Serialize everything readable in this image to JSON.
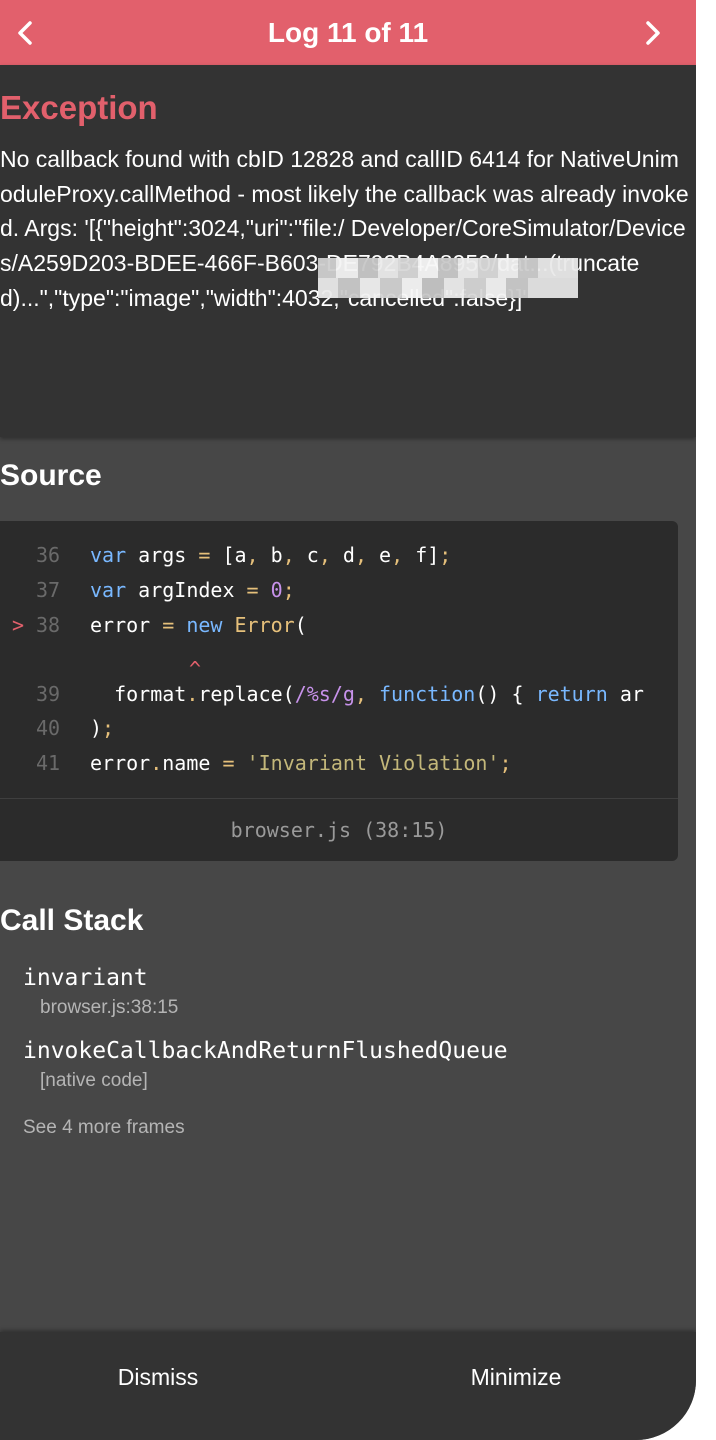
{
  "header": {
    "title": "Log 11 of 11",
    "background_color": "#e2606c",
    "prev_icon": "chevron-left-icon",
    "next_icon": "chevron-right-icon"
  },
  "exception": {
    "heading": "Exception",
    "message": "No callback found with cbID 12828 and callID 6414 for NativeUnimoduleProxy.callMethod - most likely the callback was already invoked. Args: '[{\"height\":3024,\"uri\":\"file:/                            Developer/CoreSimulator/Devices/A259D203-BDEE-466F-B603-DE792B4A8950/dat...(truncated)...\",\"type\":\"image\",\"width\":4032,\"cancelled\":false}]'"
  },
  "source": {
    "title": "Source",
    "lines": [
      {
        "marker": "",
        "number": "36",
        "code": "var args = [a, b, c, d, e, f];"
      },
      {
        "marker": "",
        "number": "37",
        "code": "var argIndex = 0;"
      },
      {
        "marker": ">",
        "number": "38",
        "code": "error = new Error("
      },
      {
        "marker": "",
        "number": "",
        "code": "^"
      },
      {
        "marker": "",
        "number": "39",
        "code": "  format.replace(/%s/g, function() { return ar"
      },
      {
        "marker": "",
        "number": "40",
        "code": ");"
      },
      {
        "marker": "",
        "number": "41",
        "code": "error.name = 'Invariant Violation';"
      }
    ],
    "file_location": "browser.js (38:15)"
  },
  "call_stack": {
    "title": "Call Stack",
    "frames": [
      {
        "function": "invariant",
        "location": "browser.js:38:15"
      },
      {
        "function": "invokeCallbackAndReturnFlushedQueue",
        "location": "[native code]"
      }
    ],
    "more_label": "See 4 more frames"
  },
  "footer": {
    "dismiss_label": "Dismiss",
    "minimize_label": "Minimize"
  }
}
